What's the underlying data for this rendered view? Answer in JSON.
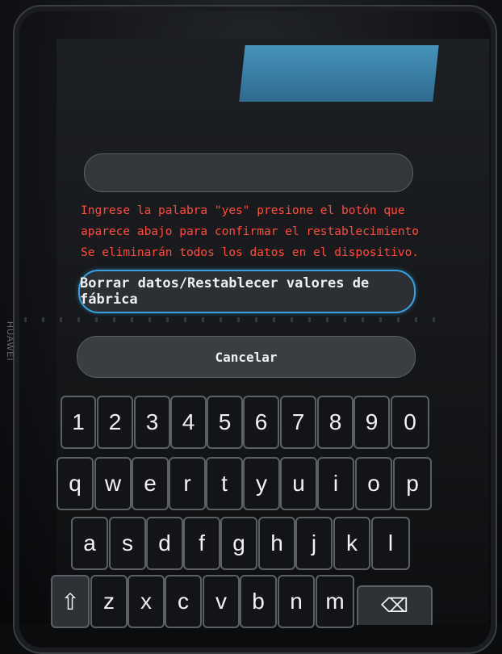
{
  "device": {
    "brand": "HUAWEI"
  },
  "prompt": {
    "line1": "Ingrese la palabra \"yes\" presione el botón que",
    "line2": "aparece abajo para confirmar el restablecimiento",
    "line3": "Se eliminarán todos los datos en el dispositivo."
  },
  "input": {
    "value": ""
  },
  "buttons": {
    "reset": "Borrar datos/Restablecer valores de fábrica",
    "cancel": "Cancelar"
  },
  "keyboard": {
    "row1": [
      "1",
      "2",
      "3",
      "4",
      "5",
      "6",
      "7",
      "8",
      "9",
      "0"
    ],
    "row2": [
      "q",
      "w",
      "e",
      "r",
      "t",
      "y",
      "u",
      "i",
      "o",
      "p"
    ],
    "row3": [
      "a",
      "s",
      "d",
      "f",
      "g",
      "h",
      "j",
      "k",
      "l"
    ],
    "row4": [
      "z",
      "x",
      "c",
      "v",
      "b",
      "n",
      "m"
    ],
    "shift_icon": "shift-arrow-icon",
    "backspace_icon": "backspace-icon",
    "shift_glyph": "⇧",
    "backspace_glyph": "⌫"
  },
  "colors": {
    "warning_text": "#ff4b3a",
    "focus_border": "#3aa0e0"
  }
}
